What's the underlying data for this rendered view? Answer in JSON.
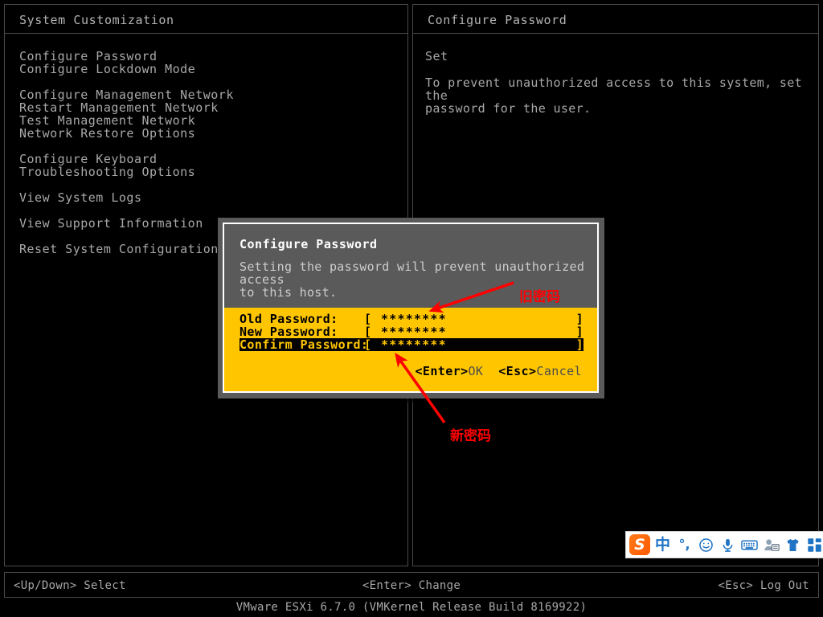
{
  "left_pane": {
    "title": "System Customization",
    "groups": [
      {
        "items": [
          "Configure Password",
          "Configure Lockdown Mode"
        ]
      },
      {
        "items": [
          "Configure Management Network",
          "Restart Management Network",
          "Test Management Network",
          "Network Restore Options"
        ]
      },
      {
        "items": [
          "Configure Keyboard",
          "Troubleshooting Options"
        ]
      },
      {
        "items": [
          "View System Logs"
        ]
      },
      {
        "items": [
          "View Support Information"
        ]
      },
      {
        "items": [
          "Reset System Configuration"
        ]
      }
    ]
  },
  "right_pane": {
    "title": "Configure Password",
    "subtitle": "Set",
    "body": "To prevent unauthorized access to this system, set the\npassword for the user."
  },
  "dialog": {
    "title": "Configure Password",
    "description": "Setting the password will prevent unauthorized access\nto this host.",
    "fields": [
      {
        "label": "Old Password:",
        "open": "[",
        "value": "********",
        "close": "]",
        "selected": false
      },
      {
        "label": "New Password:",
        "open": "[",
        "value": "********",
        "close": "]",
        "selected": false
      },
      {
        "label": "Confirm Password:",
        "open": "[",
        "value": "********",
        "close": "]",
        "selected": true
      }
    ],
    "actions": {
      "ok_key": "<Enter>",
      "ok_label": "OK",
      "cancel_key": "<Esc>",
      "cancel_label": "Cancel"
    },
    "colors": {
      "header_bg": "#5a5a5a",
      "form_bg": "#ffc600",
      "border": "#ffffff",
      "selected_bg": "#000000",
      "selected_fg": "#ffc600"
    }
  },
  "annotations": {
    "color": "#ff0000",
    "old_password_label": "旧密码",
    "new_password_label": "新密码"
  },
  "statusbar": {
    "left_key": "<Up/Down>",
    "left_label": "Select",
    "center_key": "<Enter>",
    "center_label": "Change",
    "right_key": "<Esc>",
    "right_label": "Log Out"
  },
  "version": "VMware ESXi 6.7.0 (VMKernel Release Build 8169922)",
  "ime": {
    "logo": "S",
    "mode": "中",
    "punctuation": "°,",
    "icons": [
      "sogou-logo-icon",
      "chinese-mode-icon",
      "punctuation-mode-icon",
      "emoji-icon",
      "microphone-icon",
      "keyboard-icon",
      "user-card-icon",
      "skin-icon",
      "apps-grid-icon"
    ],
    "accent": "#1f73c4"
  }
}
